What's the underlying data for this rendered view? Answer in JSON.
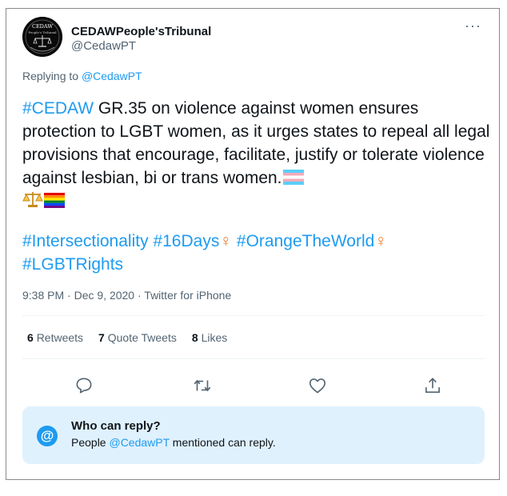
{
  "tweet": {
    "author": {
      "display_name": "CEDAWPeople'sTribunal",
      "handle": "@CedawPT",
      "avatar_text_top": "CEDAW",
      "avatar_text_mid": "People's Tribunal"
    },
    "more_label": "···",
    "replying_prefix": "Replying to",
    "replying_to": "@CedawPT",
    "body": {
      "p1_tag": "#CEDAW",
      "p1_text": " GR.35 on violence against women ensures protection to LGBT women, as it urges states to repeal all legal provisions that encourage, facilitate, justify or tolerate violence against lesbian, bi or trans women.",
      "p2_tag1": "#Intersectionality",
      "p2_tag2": "#16Days",
      "p2_tag3": "#OrangeTheWorld",
      "p2_tag4": "#LGBTRights",
      "female_sign": "♀"
    },
    "time": "9:38 PM",
    "date": "Dec 9, 2020",
    "source": "Twitter for iPhone",
    "separator": " · ",
    "stats": {
      "retweets_count": "6",
      "retweets_label": "Retweets",
      "quotes_count": "7",
      "quotes_label": "Quote Tweets",
      "likes_count": "8",
      "likes_label": "Likes"
    },
    "actions": [
      "reply-icon",
      "retweet-icon",
      "like-icon",
      "share-icon"
    ],
    "who_can_reply": {
      "icon_glyph": "@",
      "title": "Who can reply?",
      "text_prefix": "People ",
      "mention": "@CedawPT",
      "text_suffix": " mentioned can reply."
    }
  },
  "colors": {
    "accent": "#1d9bf0",
    "secondary_text": "#536471",
    "reply_box_bg": "#dff1fd",
    "female_sign": "#f07a2a"
  }
}
